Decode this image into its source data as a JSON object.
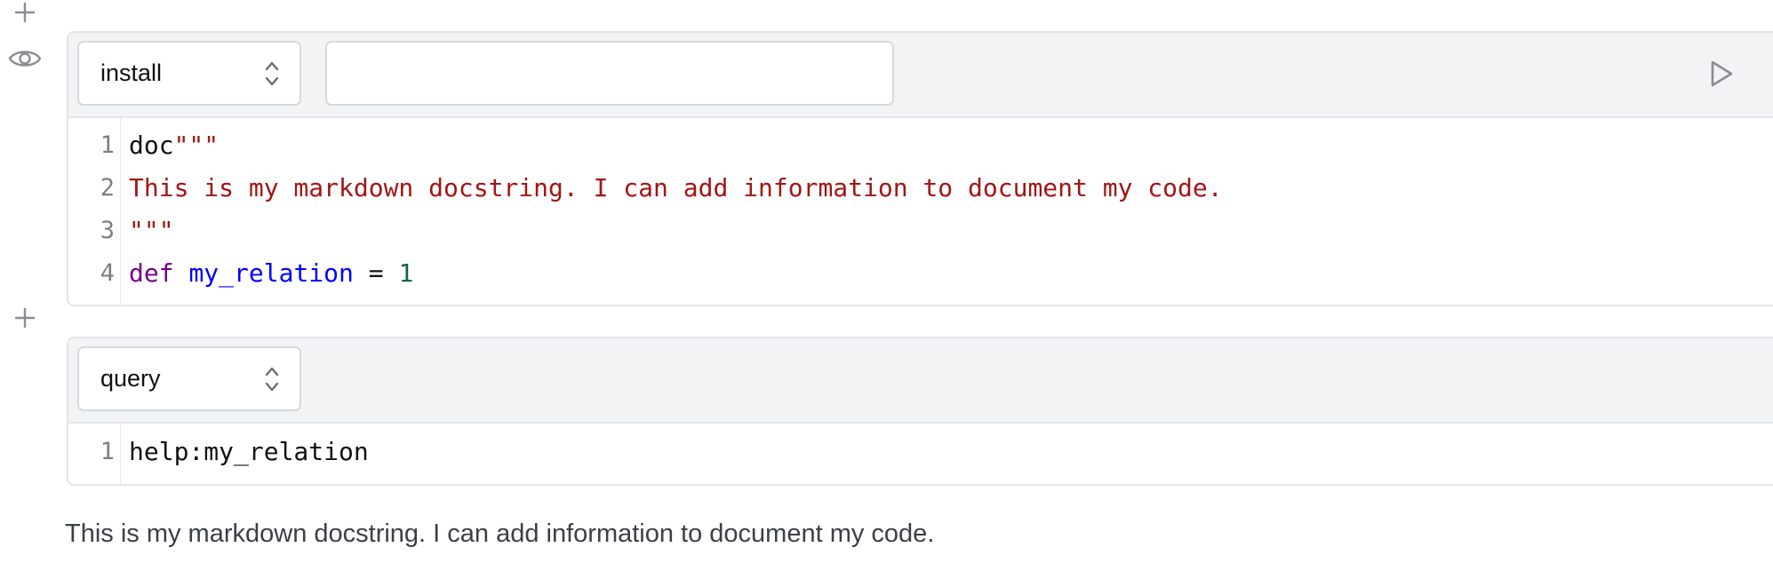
{
  "gutter": {
    "add_cell_top_icon": "plus-icon",
    "visibility_icon": "eye-icon",
    "add_cell_mid_icon": "plus-icon"
  },
  "cells": [
    {
      "type_label": "install",
      "input_value": "",
      "run_icon": "play-icon",
      "lines": [
        {
          "no": "1",
          "doc": "doc",
          "str": "\"\"\""
        },
        {
          "no": "2",
          "str": "This is my markdown docstring. I can add information to document my code."
        },
        {
          "no": "3",
          "str": "\"\"\""
        },
        {
          "no": "4",
          "kw": "def",
          "name": "my_relation",
          "op": " = ",
          "num": "1"
        }
      ]
    },
    {
      "type_label": "query",
      "lines": [
        {
          "no": "1",
          "code": "help:my_relation"
        }
      ]
    }
  ],
  "output": {
    "text": "This is my markdown docstring. I can add information to document my code."
  },
  "colors": {
    "string": "#a31515",
    "keyword": "#770088",
    "definition": "#0000ff",
    "number": "#116644",
    "cell_border": "#e2e4e9",
    "header_bg": "#f2f3f5"
  }
}
